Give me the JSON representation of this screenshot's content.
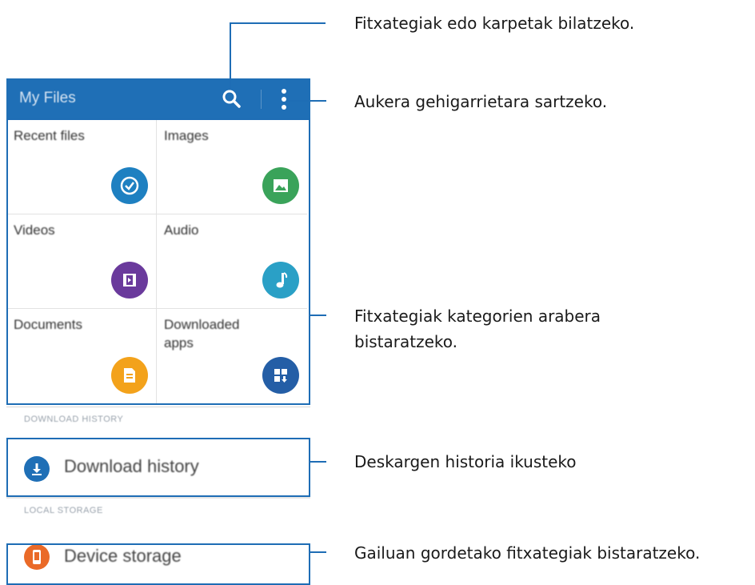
{
  "app": {
    "title": "My Files",
    "search_icon": "search-icon",
    "more_icon": "more-vert-icon"
  },
  "categories": [
    {
      "label": "Recent files",
      "icon": "clock-check-icon",
      "color": "#1e80c1"
    },
    {
      "label": "Images",
      "icon": "image-icon",
      "color": "#3aa35a"
    },
    {
      "label": "Videos",
      "icon": "film-icon",
      "color": "#6a3a9c"
    },
    {
      "label": "Audio",
      "icon": "music-note-icon",
      "color": "#2aa0c6"
    },
    {
      "label": "Documents",
      "icon": "document-icon",
      "color": "#f3a21b"
    },
    {
      "label": "Downloaded apps",
      "icon": "apps-download-icon",
      "color": "#245ea6"
    }
  ],
  "sections": {
    "download_history_header": "DOWNLOAD HISTORY",
    "local_storage_header": "LOCAL STORAGE"
  },
  "rows": {
    "download_history": {
      "label": "Download history",
      "icon": "download-icon",
      "color": "#1f6fb6"
    },
    "device_storage": {
      "label": "Device storage",
      "icon": "phone-icon",
      "color": "#ea6a28"
    }
  },
  "callouts": {
    "search": "Fitxategiak edo karpetak bilatzeko.",
    "more": "Aukera gehigarrietara sartzeko.",
    "categories_line1": "Fitxategiak kategorien arabera",
    "categories_line2": "bistaratzeko.",
    "history": "Deskargen historia ikusteko",
    "storage": "Gailuan gordetako fitxategiak bistaratzeko."
  },
  "colors": {
    "accent": "#1e6db5",
    "appbar": "#1f6fb6"
  }
}
